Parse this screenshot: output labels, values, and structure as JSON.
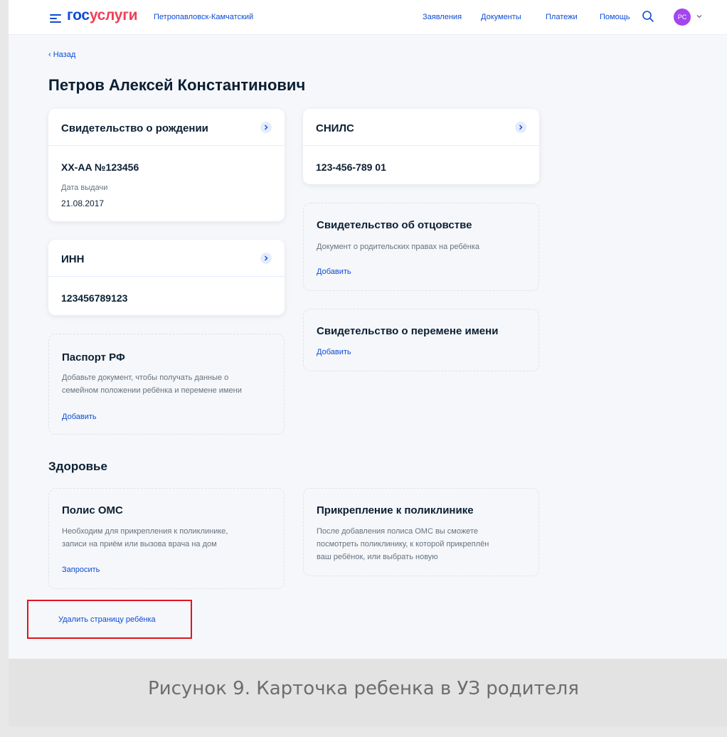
{
  "header": {
    "logo_part1": "гос",
    "logo_part2": "услуги",
    "city": "Петропавловск-Камчатский",
    "nav": [
      "Заявления",
      "Документы",
      "Платежи",
      "Помощь"
    ],
    "avatar_initials": "PC",
    "brand_color": "#0d4cd3",
    "avatar_color": "#a445f0"
  },
  "page": {
    "back": "‹ Назад",
    "title": "Петров Алексей Константинович"
  },
  "cards": {
    "birth_cert": {
      "title": "Свидетельство о рождении",
      "number": "XX-AA №123456",
      "issue_label": "Дата выдачи",
      "issue_date": "21.08.2017"
    },
    "snils": {
      "title": "СНИЛС",
      "number": "123-456-789 01"
    },
    "inn": {
      "title": "ИНН",
      "number": "123456789123"
    },
    "passport": {
      "title": "Паспорт РФ",
      "desc_line1": "Добавьте документ, чтобы получать данные о",
      "desc_line2": "семейном положении ребёнка и перемене имени",
      "link": "Добавить"
    },
    "paternity": {
      "title": "Свидетельство об отцовстве",
      "desc": "Документ о родительских правах на ребёнка",
      "link": "Добавить"
    },
    "name_change": {
      "title": "Свидетельство о перемене имени",
      "link": "Добавить"
    }
  },
  "health": {
    "title": "Здоровье",
    "oms": {
      "title": "Полис ОМС",
      "desc_line1": "Необходим для прикрепления к поликлинике,",
      "desc_line2": "записи на приём или вызова врача на дом",
      "link": "Запросить"
    },
    "clinic": {
      "title": "Прикрепление к поликлинике",
      "desc_line1": "После добавления полиса ОМС вы сможете",
      "desc_line2": "посмотреть поликлинику, к которой прикреплён",
      "desc_line3": "ваш ребёнок, или выбрать новую"
    }
  },
  "delete_link": "Удалить страницу ребёнка",
  "highlight_color": "#e3141d",
  "caption": "Рисунок 9. Карточка ребенка в УЗ родителя"
}
